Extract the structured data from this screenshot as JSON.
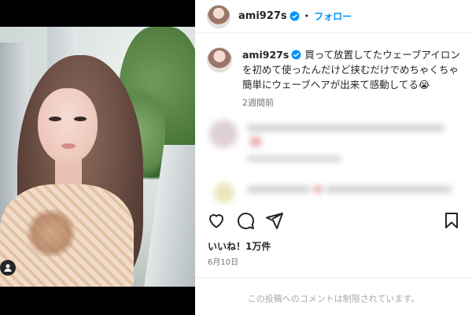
{
  "post": {
    "username": "ami927s",
    "follow_label": "フォロー",
    "separator": "•",
    "caption": "買って放置してたウェーブアイロンを初めて使ったんだけど挟むだけでめちゃくちゃ簡単にウェーブヘアが出来て感動してる😭",
    "time_ago": "2週間前",
    "likes": "いいね！1万件",
    "date": "6月10日",
    "comments_restricted": "この投稿へのコメントは制限されています。"
  },
  "icons": {
    "like": "heart-icon",
    "comment": "comment-icon",
    "share": "share-icon",
    "save": "bookmark-icon",
    "verified": "verified-badge-icon",
    "tagged_user": "user-tag-icon"
  },
  "colors": {
    "accent": "#0095f6",
    "muted": "#737373",
    "restricted": "#a8a8a8"
  }
}
